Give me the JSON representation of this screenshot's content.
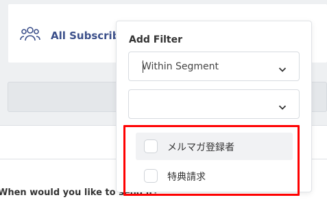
{
  "background": {
    "audience_label": "All Subscribe",
    "question": "When would you like to send it?"
  },
  "filter": {
    "title": "Add Filter",
    "type_select_value": "Within Segment",
    "segment_select_value": "",
    "options": [
      {
        "label": "メルマガ登録者",
        "checked": false,
        "highlighted": true
      },
      {
        "label": "特典請求",
        "checked": false,
        "highlighted": false
      }
    ]
  },
  "colors": {
    "accent_text": "#3b4f8a",
    "highlight_border": "#ff0000",
    "page_bg": "#eef0f2"
  },
  "icons": {
    "audience": "people-group-icon",
    "select_chevron": "chevron-down-icon"
  }
}
